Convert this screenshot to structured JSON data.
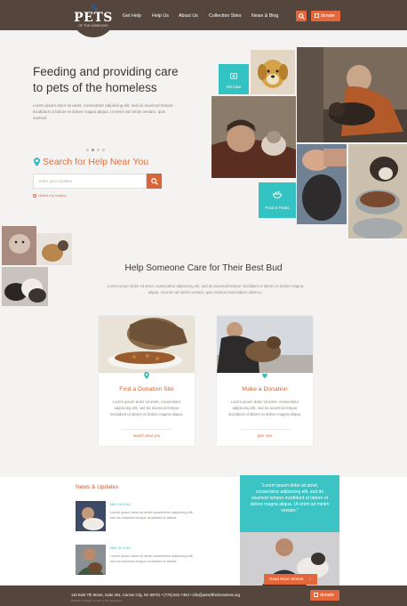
{
  "header": {
    "logo_text": "PETS",
    "logo_sub": "OF THE HOMELESS",
    "nav": [
      "Get Help",
      "Help Us",
      "About Us",
      "Collection Sites",
      "News & Blog"
    ],
    "donate_label": "donate",
    "colors": {
      "bar": "#54463d",
      "accent": "#e3673a"
    }
  },
  "hero": {
    "title_line1": "Feeding and providing care",
    "title_line2": "to pets of the homeless",
    "body": "Lorem ipsum dolor sit amet, consectetur adipiscing elit, sed do eiusmod tempor incididunt ut labore et dolore magna aliqua. Ut enim ad minim veniam, quis nostrud",
    "search_title": "Search for Help Near You",
    "search_placeholder": "enter your location",
    "detect_label": "detect my location",
    "slider_total": 4,
    "slider_active": 1
  },
  "collage": {
    "vet_care_label": "Vet Care",
    "food_label": "Food & Treats"
  },
  "bud": {
    "title": "Help Someone Care for Their Best Bud",
    "body": "Lorem ipsum dolor sit amet, consectetur adipiscing elit, sed do eiusmod tempor incididunt ut labore et dolore magna aliqua. Ut enim ad minim veniam, quis nostrud exercitation ullamco.",
    "cards": [
      {
        "title": "Find a Donation Site",
        "body": "Lorem ipsum dolor sit amet, consectetur adipiscing elit, sed do eiusmod tempor incididunt ut labore et dolore magna aliqua.",
        "link": "search near you"
      },
      {
        "title": "Make a Donation",
        "body": "Lorem ipsum dolor sit amet, consectetur adipiscing elit, sed do eiusmod tempor incididunt ut labore et dolore magna aliqua.",
        "link": "give now"
      }
    ]
  },
  "news": {
    "title": "News & Updates",
    "items": [
      {
        "date": "MAY 26 2016",
        "text": "Lorem ipsum dolor sit amet consectetur adipiscing elit, sed do eiusmod tempor incididunt ut labore."
      },
      {
        "date": "MAY 20 2016",
        "text": "Lorem ipsum dolor sit amet consectetur adipiscing elit, sed do eiusmod tempor incididunt ut labore."
      }
    ],
    "quote": "“Lorem ipsum dolor sit amet, consectetur adipiscing elit, sed do eiusmod tempor incididunt ut labore et dolore magna aliqua. Ut enim ad minim veniam.”",
    "stories_button": "Read More Stories"
  },
  "footer": {
    "address": "116 East 7th Street, Suite 204, Carson City, NV 89701  •  (775) 841-7463  •  info@petsofthehomeless.org",
    "sub": "Website & Design by Pets of the Homeless",
    "donate_label": "donate"
  }
}
